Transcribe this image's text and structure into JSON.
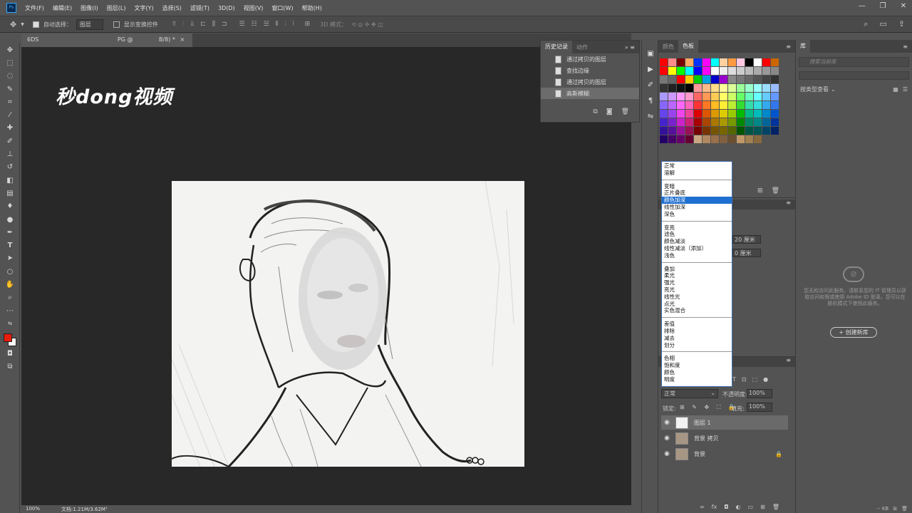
{
  "menubar": {
    "items": [
      "文件(F)",
      "编辑(E)",
      "图像(I)",
      "图层(L)",
      "文字(Y)",
      "选择(S)",
      "滤镜(T)",
      "3D(D)",
      "视图(V)",
      "窗口(W)",
      "帮助(H)"
    ]
  },
  "options": {
    "auto_select_label": "自动选择：",
    "auto_select_value": "图层",
    "show_transform_label": "显示变换控件",
    "mode3d_label": "3D 模式："
  },
  "document": {
    "tab_left": "6DS",
    "tab_mid": "PG @ ",
    "tab_right": "B/8) *",
    "watermark": "秒dong视频",
    "zoom": "100%",
    "doc_size": "文档:1.21M/3.62M"
  },
  "history": {
    "tabs": [
      "历史记录",
      "动作"
    ],
    "items": [
      "通过拷贝的图层",
      "查找边缘",
      "通过拷贝的图层",
      "高斯模糊"
    ]
  },
  "swatches": {
    "tabs": [
      "颜色",
      "色板"
    ],
    "colors": [
      "#ff0000",
      "#ff8a8a",
      "#7a0000",
      "#fdaa64",
      "#0033ff",
      "#ff00ff",
      "#00ffff",
      "#ffd0a0",
      "#ff9a40",
      "#ffc8e0",
      "#000000",
      "#ffffff",
      "#ff0000",
      "#cc6600",
      "#ff0000",
      "#ffff00",
      "#00ff00",
      "#00ffff",
      "#0000ff",
      "#ff00ff",
      "#ffffff",
      "#eeeeee",
      "#dddddd",
      "#cccccc",
      "#bbbbbb",
      "#aaaaaa",
      "#999999",
      "#888888",
      "#777777",
      "#666666",
      "#ff0000",
      "#ffcc00",
      "#00cc00",
      "#00a0e0",
      "#0000cc",
      "#9900cc",
      "#888888",
      "#777777",
      "#666666",
      "#555555",
      "#444444",
      "#333333",
      "#333333",
      "#222222",
      "#111111",
      "#000000",
      "#ff9999",
      "#ffbb88",
      "#ffdd88",
      "#ffff99",
      "#ddff99",
      "#99ff99",
      "#99ffcc",
      "#99ffff",
      "#99ddff",
      "#99bbff",
      "#aa99ff",
      "#cc99ff",
      "#ff99ff",
      "#ff99cc",
      "#ff6666",
      "#ff9955",
      "#ffcc55",
      "#ffff66",
      "#ccff66",
      "#66ff66",
      "#66ffbb",
      "#66ffff",
      "#66ccff",
      "#6699ff",
      "#8866ff",
      "#bb66ff",
      "#ff66ff",
      "#ff66bb",
      "#ff3333",
      "#ff7722",
      "#ffbb22",
      "#ffee33",
      "#bbee33",
      "#33dd33",
      "#33ddaa",
      "#33dddd",
      "#33aaee",
      "#3377ee",
      "#6644ee",
      "#9944ee",
      "#ee44ee",
      "#ee4499",
      "#dd0000",
      "#dd5500",
      "#dd9900",
      "#ddcc00",
      "#99cc00",
      "#00bb00",
      "#00bb88",
      "#00bbbb",
      "#0088cc",
      "#0055cc",
      "#4422cc",
      "#7722cc",
      "#cc22cc",
      "#cc2277",
      "#aa0000",
      "#aa4400",
      "#aa7700",
      "#aa9900",
      "#779900",
      "#008800",
      "#008866",
      "#008888",
      "#006699",
      "#003399",
      "#331199",
      "#551199",
      "#991199",
      "#991155",
      "#770000",
      "#773300",
      "#775500",
      "#776600",
      "#556600",
      "#005500",
      "#005544",
      "#005555",
      "#004466",
      "#002266",
      "#220066",
      "#440066",
      "#660066",
      "#660033",
      "#c8a882",
      "#b08860",
      "#98704a",
      "#806040",
      "#6a5030",
      "#c09868",
      "#a08050",
      "#886a3e"
    ]
  },
  "blend_modes": {
    "groups": [
      [
        "正常",
        "溶解"
      ],
      [
        "变暗",
        "正片叠底",
        "颜色加深",
        "线性加深",
        "深色"
      ],
      [
        "变亮",
        "滤色",
        "颜色减淡",
        "线性减淡（添加）",
        "浅色"
      ],
      [
        "叠加",
        "柔光",
        "强光",
        "亮光",
        "线性光",
        "点光",
        "实色混合"
      ],
      [
        "差值",
        "排除",
        "减去",
        "划分"
      ],
      [
        "色相",
        "饱和度",
        "颜色",
        "明度"
      ]
    ],
    "highlighted": "颜色加深"
  },
  "properties": {
    "width_value": "20 厘米",
    "height_value": "0 厘米"
  },
  "layers": {
    "blend_value": "正常",
    "opacity_label": "不透明度:",
    "opacity_value": "100%",
    "lock_label": "锁定:",
    "fill_label": "填充:",
    "fill_value": "100%",
    "rows": [
      "图层 1",
      "背景 拷贝",
      "背景"
    ]
  },
  "library": {
    "tab": "库",
    "search_placeholder": "搜索当前库",
    "view_label": "按类型查看",
    "message": "您无权访问此服务。请联系您的 IT 管理员以获取访问权限或使用 Adobe ID 登录。您可以在脱机模式下使用此服务。",
    "create_button": "+ 创建新库",
    "size_label": "-- KB"
  }
}
